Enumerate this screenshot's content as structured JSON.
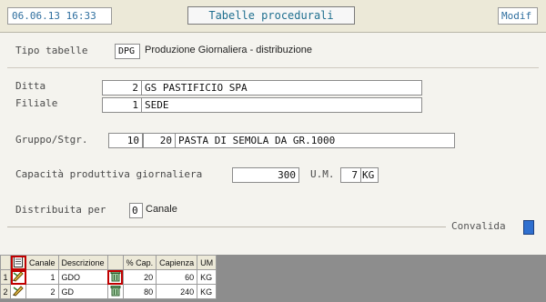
{
  "header": {
    "datetime": "06.06.13 16:33",
    "title": "Tabelle procedurali",
    "mode": "Modif"
  },
  "form": {
    "tipo_label": "Tipo tabelle",
    "tipo_code": "DPG",
    "tipo_desc": "Produzione Giornaliera - distribuzione",
    "ditta_label": "Ditta",
    "ditta_code": "2",
    "ditta_desc": "GS PASTIFICIO SPA",
    "filiale_label": "Filiale",
    "filiale_code": "1",
    "filiale_desc": "SEDE",
    "gruppo_label": "Gruppo/Stgr.",
    "gruppo_code": "10",
    "stgr_code": "20",
    "gruppo_desc": "PASTA DI SEMOLA DA GR.1000",
    "capacita_label": "Capacità produttiva giornaliera",
    "capacita_value": "300",
    "um_label": "U.M.",
    "um_code": "7",
    "um_desc": "KG",
    "distribuita_label": "Distribuita per",
    "distribuita_value": "0",
    "distribuita_desc": "Canale",
    "convalida_label": "Convalida"
  },
  "grid": {
    "columns": [
      "Canale",
      "Descrizione",
      "",
      "% Cap.",
      "Capienza",
      "UM"
    ],
    "rows": [
      {
        "n": "1",
        "canale": "1",
        "descrizione": "GDO",
        "cap": "20",
        "capienza": "60",
        "um": "KG"
      },
      {
        "n": "2",
        "canale": "2",
        "descrizione": "GD",
        "cap": "80",
        "capienza": "240",
        "um": "KG"
      }
    ]
  }
}
